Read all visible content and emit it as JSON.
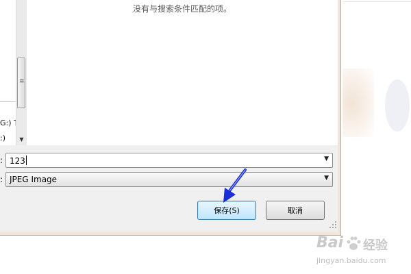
{
  "navigation": {
    "items": [
      {
        "label": "G:) T"
      },
      {
        "label": ":)"
      }
    ]
  },
  "results": {
    "empty_message": "没有与搜索条件匹配的项。"
  },
  "filename_field": {
    "label_suffix": ":",
    "value": "123"
  },
  "filetype_field": {
    "label_suffix": ":",
    "value": "JPEG Image"
  },
  "buttons": {
    "save": "保存(S)",
    "cancel": "取消"
  },
  "watermark": {
    "brand": "Bai",
    "suffix": "经验",
    "url": "jingyan.baidu.com"
  },
  "colors": {
    "arrow": "#1a2fd8",
    "primary_button_border": "#3c7fb1"
  }
}
